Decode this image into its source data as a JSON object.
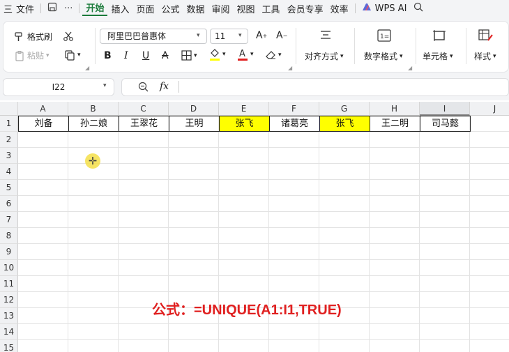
{
  "menubar": {
    "items": [
      "三",
      "文件",
      "开始",
      "插入",
      "页面",
      "公式",
      "数据",
      "审阅",
      "视图",
      "工具",
      "会员专享",
      "效率",
      "WPS AI"
    ],
    "active": "开始"
  },
  "ribbon": {
    "format_painter": "格式刷",
    "paste": "粘贴",
    "font_name": "阿里巴巴普惠体",
    "font_size": "11",
    "bold": "B",
    "italic": "I",
    "underline": "U",
    "strike": "A",
    "align": "对齐方式",
    "number_format": "数字格式",
    "cell": "单元格",
    "styles": "样式",
    "fill_color": "#ffff00",
    "font_color": "#e02020"
  },
  "formula_bar": {
    "name_box": "I22",
    "fx": "fx",
    "content": ""
  },
  "sheet": {
    "columns": [
      "A",
      "B",
      "C",
      "D",
      "E",
      "F",
      "G",
      "H",
      "I",
      "J"
    ],
    "selected_column": "I",
    "rows": [
      "1",
      "2",
      "3",
      "4",
      "5",
      "6",
      "7",
      "8",
      "9",
      "10",
      "11",
      "12",
      "13",
      "14",
      "15"
    ],
    "row1_values": [
      "刘备",
      "孙二娘",
      "王翠花",
      "王明",
      "张飞",
      "诸葛亮",
      "张飞",
      "王二明",
      "司马懿"
    ],
    "highlight_color": "#ffff00"
  },
  "annotation": "公式：=UNIQUE(A1:I1,TRUE)"
}
